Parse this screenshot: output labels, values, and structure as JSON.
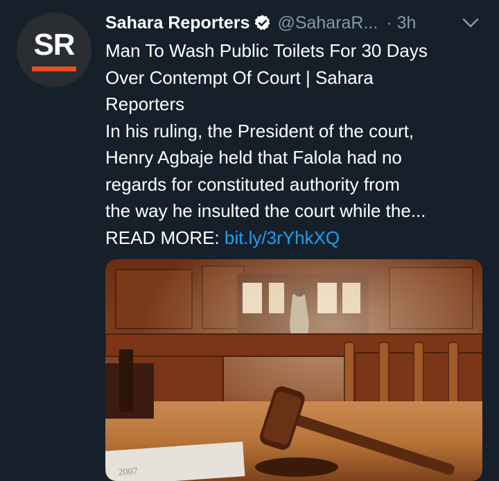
{
  "tweet": {
    "avatar_text": "SR",
    "author_name": "Sahara Reporters",
    "handle": "@SaharaR...",
    "time": "· 3h",
    "text_lines": [
      "Man To Wash Public Toilets For 30 Days",
      "Over Contempt Of Court | Sahara",
      "Reporters",
      "In his ruling, the President of the court,",
      "Henry Agbaje held that Falola had no",
      "regards for constituted authority from",
      "the way he insulted the court while the..."
    ],
    "read_more_label": "READ MORE: ",
    "link_text": "bit.ly/3rYhkXQ",
    "image_stamp_text": "2007"
  },
  "colors": {
    "background": "#15202b",
    "text": "#ffffff",
    "secondary": "#8899a6",
    "link": "#1da1f2",
    "brand_orange": "#ef4b22"
  },
  "icons": {
    "verified": "verified-badge-icon",
    "menu": "chevron-down-icon"
  }
}
